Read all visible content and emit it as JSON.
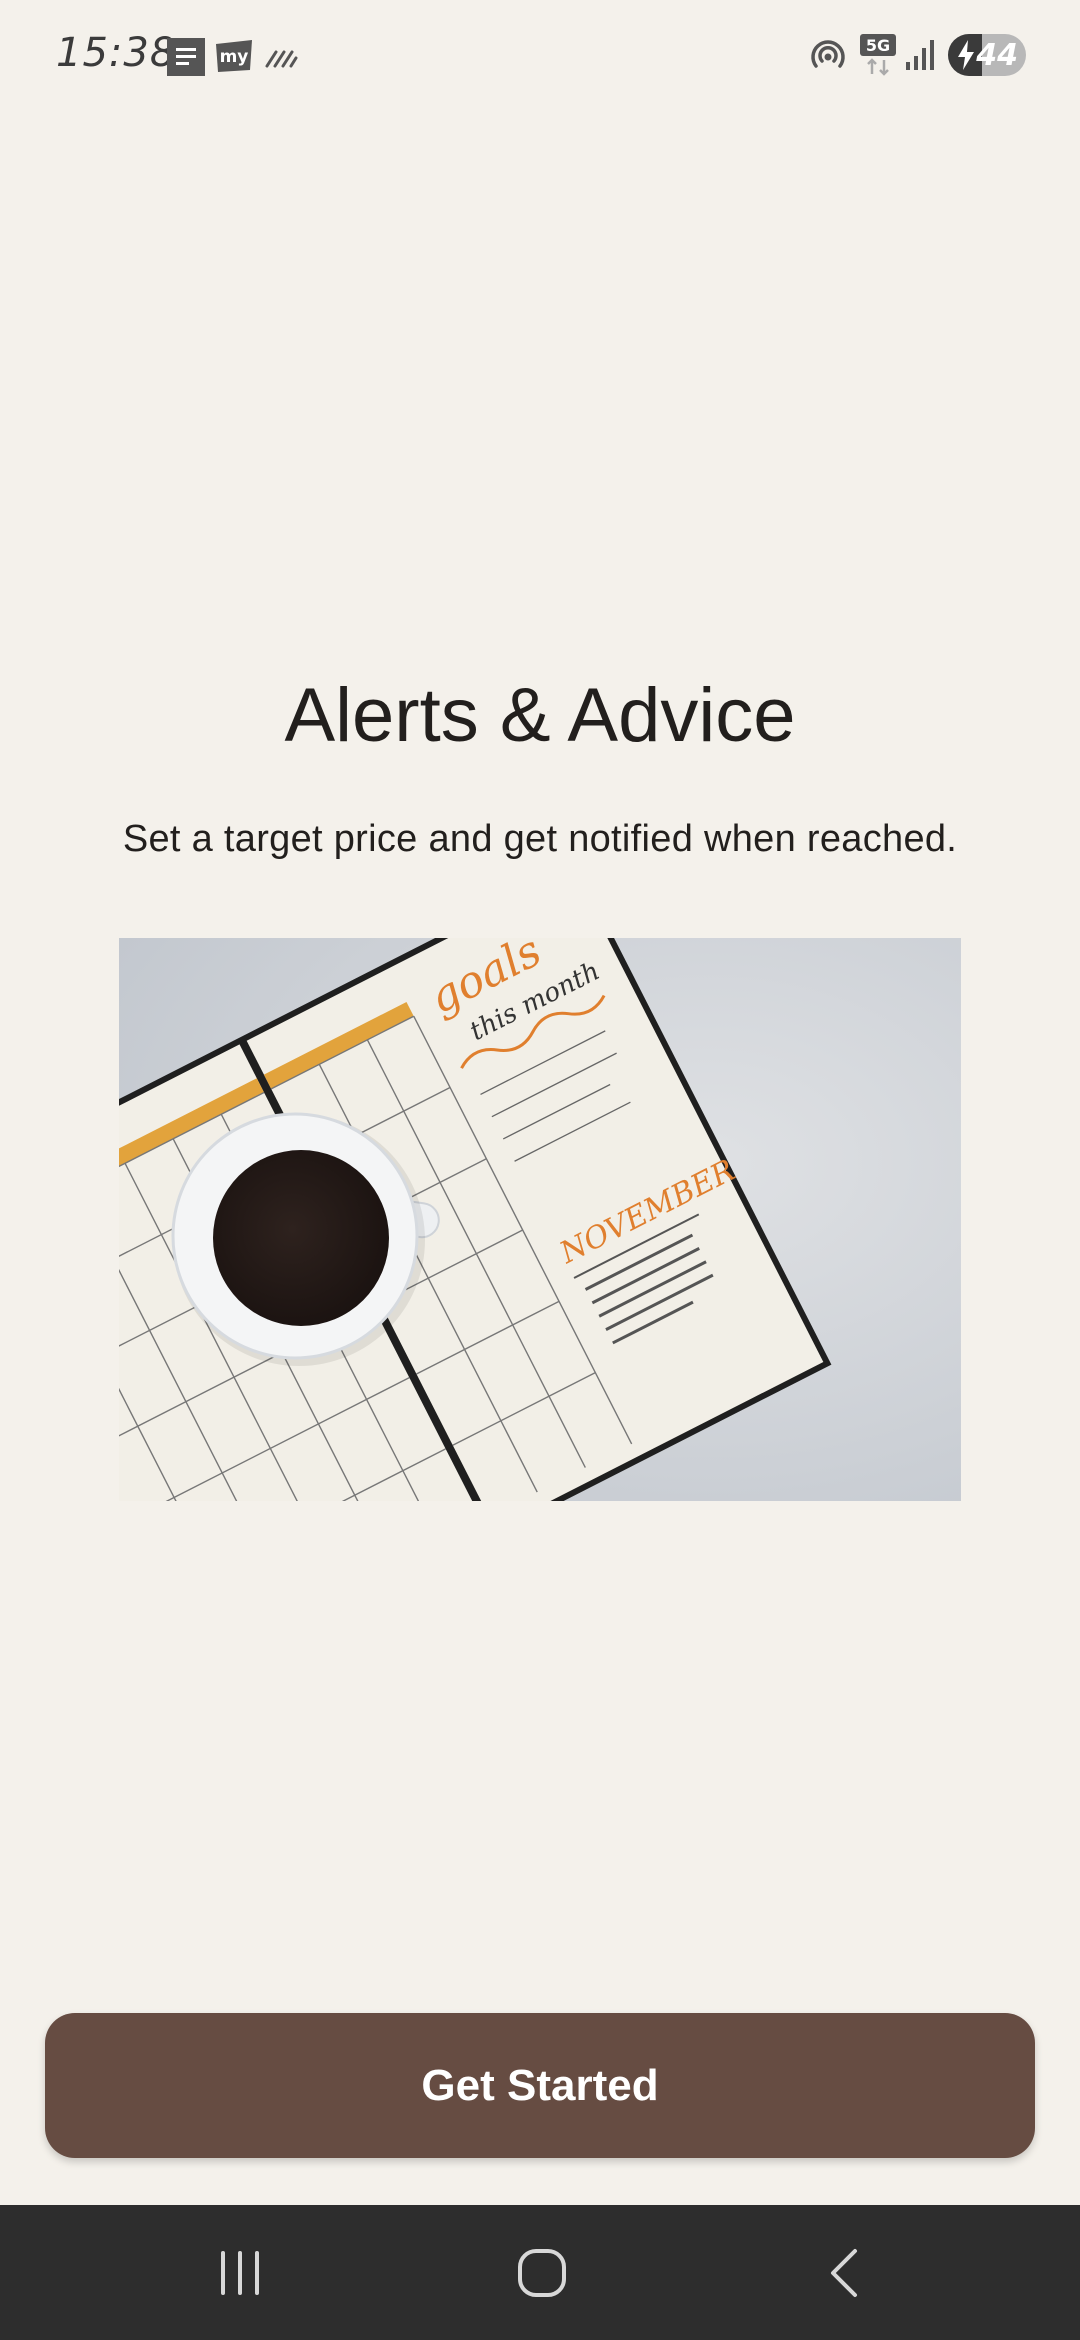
{
  "status_bar": {
    "time": "15:38",
    "battery_level": "44",
    "battery_fraction": 0.44,
    "network": "5G",
    "icons": [
      "doc-notification-icon",
      "my-app-notification-icon",
      "dashes-notification-icon",
      "hotspot-icon",
      "net-5g-icon",
      "signal-icon",
      "battery-icon"
    ]
  },
  "onboarding": {
    "title": "Alerts & Advice",
    "subtitle": "Set a target price and get notified when reached.",
    "image": {
      "planner_heading": "goals",
      "planner_sub": "this month",
      "month_label": "NOVEMBER"
    }
  },
  "actions": {
    "get_started_label": "Get Started"
  },
  "nav_bar": {
    "items": [
      "recents-icon",
      "home-icon",
      "back-icon"
    ]
  },
  "colors": {
    "background": "#f4f1eb",
    "button": "#664c42",
    "text": "#221f1d",
    "nav_bar": "#2d2d2d"
  }
}
